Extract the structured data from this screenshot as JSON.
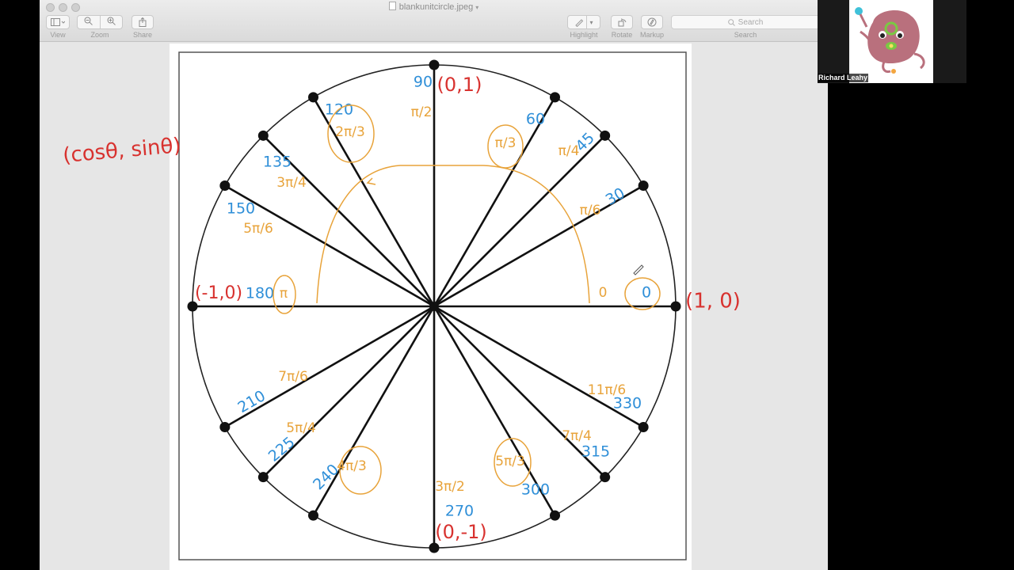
{
  "window": {
    "title": "blankunitcircle.jpeg",
    "toolbar": {
      "view_label": "View",
      "zoom_label": "Zoom",
      "share_label": "Share",
      "highlight_label": "Highlight",
      "rotate_label": "Rotate",
      "markup_label": "Markup",
      "search_placeholder": "Search",
      "search_label": "Search"
    }
  },
  "document": {
    "kind": "unit circle with 16 radial lines and handwritten annotations",
    "ink_colors": {
      "blue": "#2f8fd8",
      "orange": "#e8a33a",
      "red": "#d8322f",
      "black": "#111111"
    },
    "note_formula": "(cosθ, sinθ)",
    "axis_points": {
      "top": "(0,1)",
      "bottom": "(0,-1)",
      "left": "(-1,0)",
      "right": "(1, 0)"
    },
    "angles": [
      {
        "deg": "0",
        "rad": "0"
      },
      {
        "deg": "30",
        "rad": "π/6"
      },
      {
        "deg": "45",
        "rad": "π/4"
      },
      {
        "deg": "60",
        "rad": "π/3"
      },
      {
        "deg": "90",
        "rad": "π/2"
      },
      {
        "deg": "120",
        "rad": "2π/3"
      },
      {
        "deg": "135",
        "rad": "3π/4"
      },
      {
        "deg": "150",
        "rad": "5π/6"
      },
      {
        "deg": "180",
        "rad": "π"
      },
      {
        "deg": "210",
        "rad": "7π/6"
      },
      {
        "deg": "225",
        "rad": "5π/4"
      },
      {
        "deg": "240",
        "rad": "4π/3"
      },
      {
        "deg": "270",
        "rad": "3π/2"
      },
      {
        "deg": "300",
        "rad": "5π/3"
      },
      {
        "deg": "315",
        "rad": "7π/4"
      },
      {
        "deg": "330",
        "rad": "11π/6"
      }
    ]
  },
  "video": {
    "participant_name": "Richard Leahy",
    "avatar_icon": "cartoon-blob-character-icon"
  }
}
